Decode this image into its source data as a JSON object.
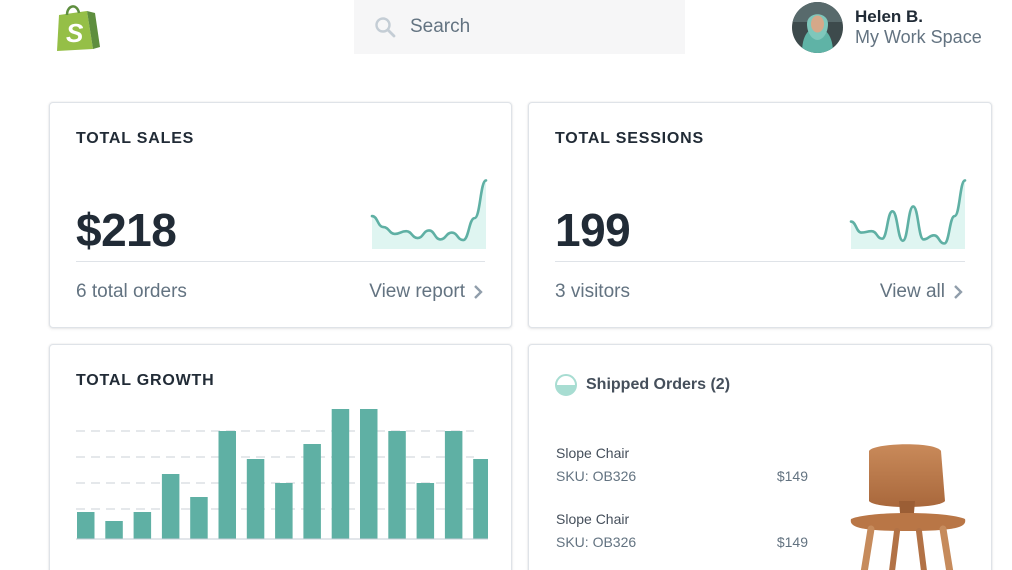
{
  "header": {
    "logo_icon": "shopify-bag-icon",
    "logo_letter": "S",
    "search": {
      "placeholder": "Search"
    },
    "user": {
      "name": "Helen B.",
      "workspace": "My Work Space"
    }
  },
  "sales_card": {
    "title": "TOTAL SALES",
    "value": "$218",
    "subtext": "6 total orders",
    "link": "View report"
  },
  "sessions_card": {
    "title": "TOTAL SESSIONS",
    "value": "199",
    "subtext": "3 visitors",
    "link": "View all"
  },
  "growth_card": {
    "title": "TOTAL GROWTH"
  },
  "orders_card": {
    "title": "Shipped Orders (2)",
    "items": [
      {
        "name": "Slope Chair",
        "sku": "SKU: OB326",
        "price": "$149"
      },
      {
        "name": "Slope Chair",
        "sku": "SKU: OB326",
        "price": "$149"
      }
    ]
  },
  "colors": {
    "accent": "#5fb0a4",
    "accent_fill": "#dff5f1",
    "brand_green": "#95bf47",
    "brand_dark": "#5e8e3e"
  },
  "chart_data": [
    {
      "type": "area",
      "series": [
        {
          "values": [
            48,
            32,
            22,
            26,
            16,
            27,
            14,
            24,
            13,
            45,
            100
          ]
        }
      ],
      "grid": false
    },
    {
      "type": "area",
      "series": [
        {
          "values": [
            40,
            24,
            26,
            15,
            55,
            12,
            62,
            14,
            20,
            8,
            48,
            100
          ]
        }
      ],
      "grid": false
    },
    {
      "type": "bar",
      "values": [
        27,
        18,
        27,
        65,
        42,
        108,
        80,
        56,
        95,
        130,
        130,
        108,
        56,
        108,
        80
      ],
      "ylim": [
        0,
        130
      ],
      "grid": true
    }
  ]
}
